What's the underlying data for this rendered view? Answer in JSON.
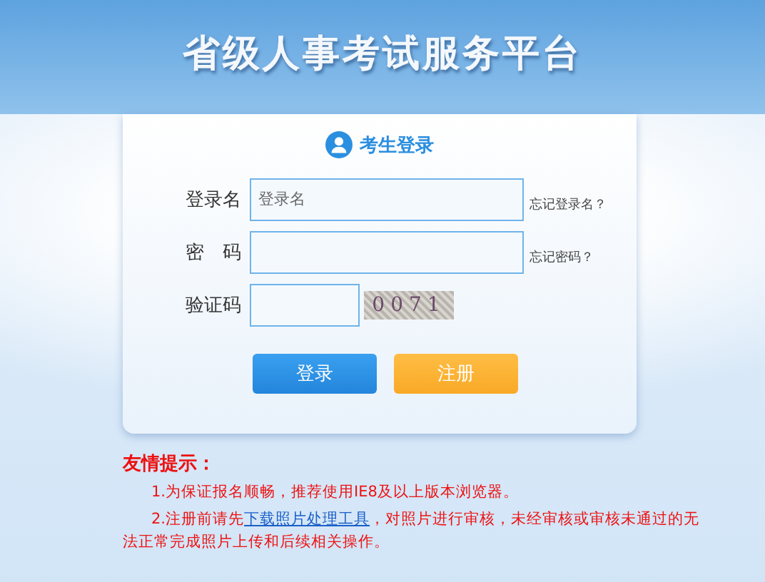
{
  "header": {
    "title": "省级人事考试服务平台"
  },
  "login_card": {
    "title": "考生登录",
    "fields": [
      {
        "label": "登录名",
        "placeholder": "登录名",
        "link": "忘记登录名？",
        "kind": "text"
      },
      {
        "label": "密　码",
        "link": "忘记密码？",
        "kind": "password"
      },
      {
        "label": "验证码",
        "captcha": "0071",
        "kind": "captcha"
      }
    ],
    "buttons": [
      {
        "label": "登录",
        "kind": "primary"
      },
      {
        "label": "注册",
        "kind": "secondary"
      }
    ]
  },
  "tips": {
    "title": "友情提示：",
    "items": [
      [
        {
          "kind": "text",
          "text": "1.为保证报名顺畅，推荐使用IE8及以上版本浏览器。"
        }
      ],
      [
        {
          "kind": "text",
          "text": "2.注册前请先"
        },
        {
          "kind": "link",
          "text": "下载照片处理工具"
        },
        {
          "kind": "text",
          "text": "，对照片进行审核，未经审核或审核未通过的无法正常完成照片上传和后续相关操作。"
        }
      ]
    ]
  }
}
